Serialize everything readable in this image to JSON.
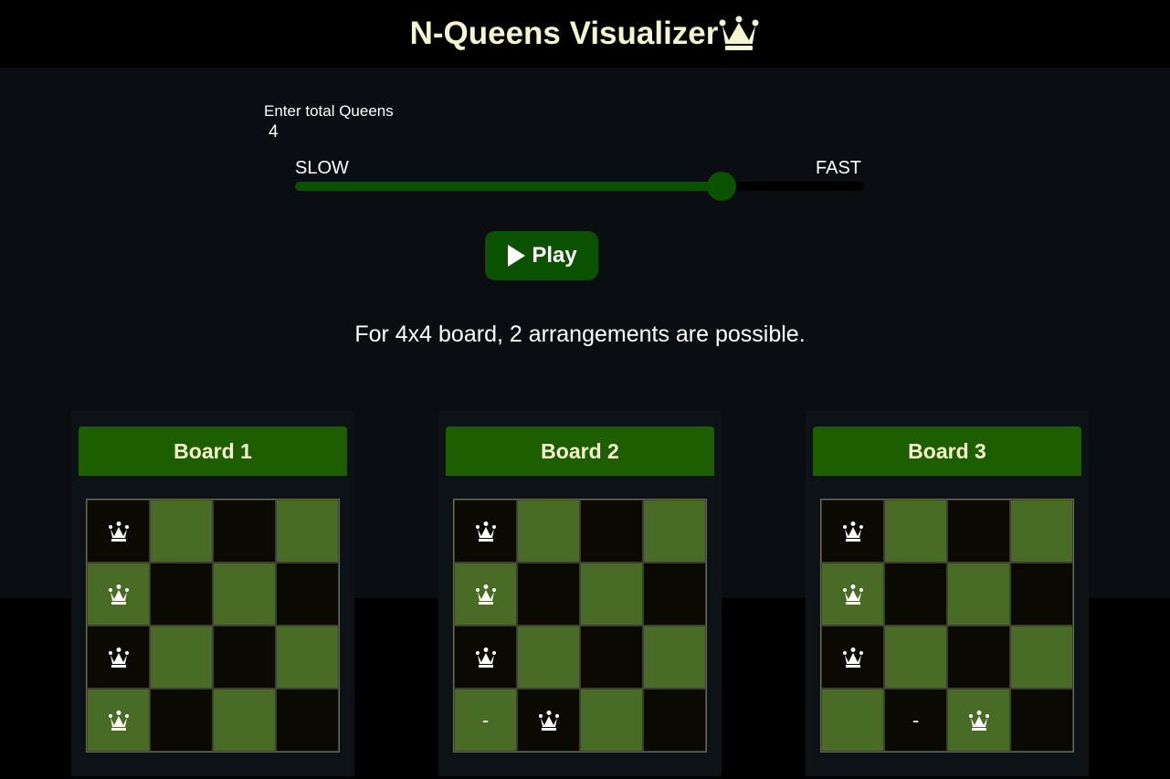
{
  "header": {
    "title": "N-Queens Visualizer"
  },
  "controls": {
    "queens_label": "Enter total Queens",
    "queens_value": "4",
    "speed_slow_label": "SLOW",
    "speed_fast_label": "FAST",
    "speed_level": 0.75,
    "play_label": "Play"
  },
  "result": {
    "text": "For 4x4 board, 2 arrangements are possible."
  },
  "boards": [
    {
      "title": "Board 1",
      "cells": [
        [
          "queen",
          "",
          "",
          ""
        ],
        [
          "queen",
          "",
          "",
          ""
        ],
        [
          "queen",
          "",
          "",
          ""
        ],
        [
          "queen",
          "",
          "",
          ""
        ]
      ]
    },
    {
      "title": "Board 2",
      "cells": [
        [
          "queen",
          "",
          "",
          ""
        ],
        [
          "queen",
          "",
          "",
          ""
        ],
        [
          "queen",
          "",
          "",
          ""
        ],
        [
          "-",
          "queen",
          "",
          ""
        ]
      ]
    },
    {
      "title": "Board 3",
      "cells": [
        [
          "queen",
          "",
          "",
          ""
        ],
        [
          "queen",
          "",
          "",
          ""
        ],
        [
          "queen",
          "",
          "",
          ""
        ],
        [
          "",
          "-",
          "queen",
          ""
        ]
      ]
    }
  ],
  "colors": {
    "accent_green": "#0b5200",
    "board_header_green": "#1c5e00",
    "light_square": "#486b25",
    "dark_square": "#0a0a03",
    "title_color": "#f5f5d0"
  },
  "icons": {
    "title_icon": "crown-icon",
    "play_icon": "play-icon",
    "queen_icon": "queen-icon"
  }
}
